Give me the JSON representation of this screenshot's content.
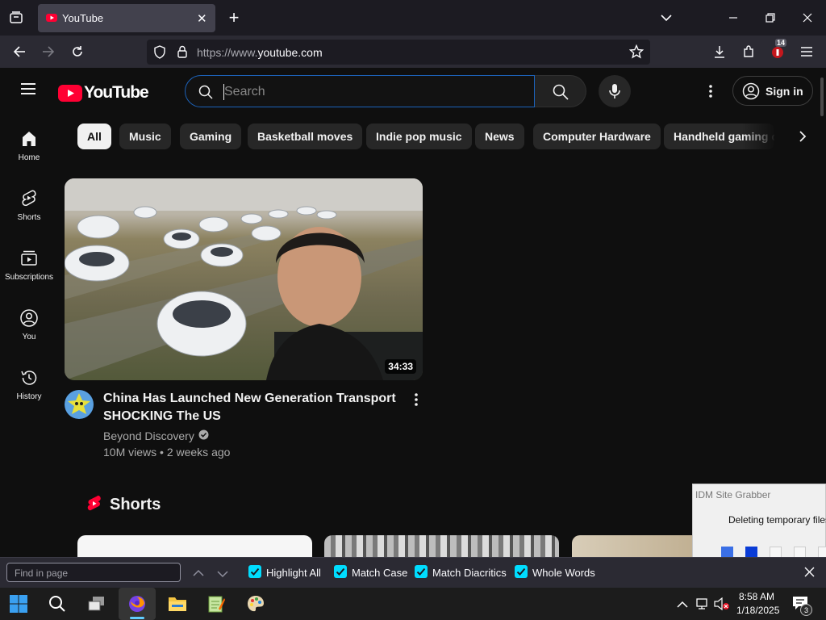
{
  "browser": {
    "tab_title": "YouTube",
    "url_prefix": "https://www.",
    "url_domain": "youtube.com",
    "extension_badge": "14"
  },
  "youtube": {
    "logo_text": "YouTube",
    "search_placeholder": "Search",
    "signin_label": "Sign in",
    "sidebar": [
      {
        "label": "Home",
        "icon": "home-icon"
      },
      {
        "label": "Shorts",
        "icon": "shorts-icon"
      },
      {
        "label": "Subscriptions",
        "icon": "subscriptions-icon"
      },
      {
        "label": "You",
        "icon": "you-icon"
      },
      {
        "label": "History",
        "icon": "history-icon"
      }
    ],
    "chips": [
      "All",
      "Music",
      "Gaming",
      "Basketball moves",
      "Indie pop music",
      "News",
      "Computer Hardware",
      "Handheld gaming c"
    ],
    "video": {
      "title": "China Has Launched New Generation Transport SHOCKING The US",
      "channel": "Beyond Discovery",
      "views": "10M views",
      "age": "2 weeks ago",
      "duration": "34:33"
    },
    "shorts_heading": "Shorts"
  },
  "findbar": {
    "placeholder": "Find in page",
    "options": [
      "Highlight All",
      "Match Case",
      "Match Diacritics",
      "Whole Words"
    ]
  },
  "idm": {
    "title": "IDM Site Grabber",
    "message": "Deleting temporary files."
  },
  "taskbar": {
    "time": "8:58 AM",
    "date": "1/18/2025",
    "notification_count": "3"
  },
  "colors": {
    "youtube_red": "#ff0033",
    "checkbox_accent": "#00ddff",
    "search_focus": "#1c62b9"
  }
}
